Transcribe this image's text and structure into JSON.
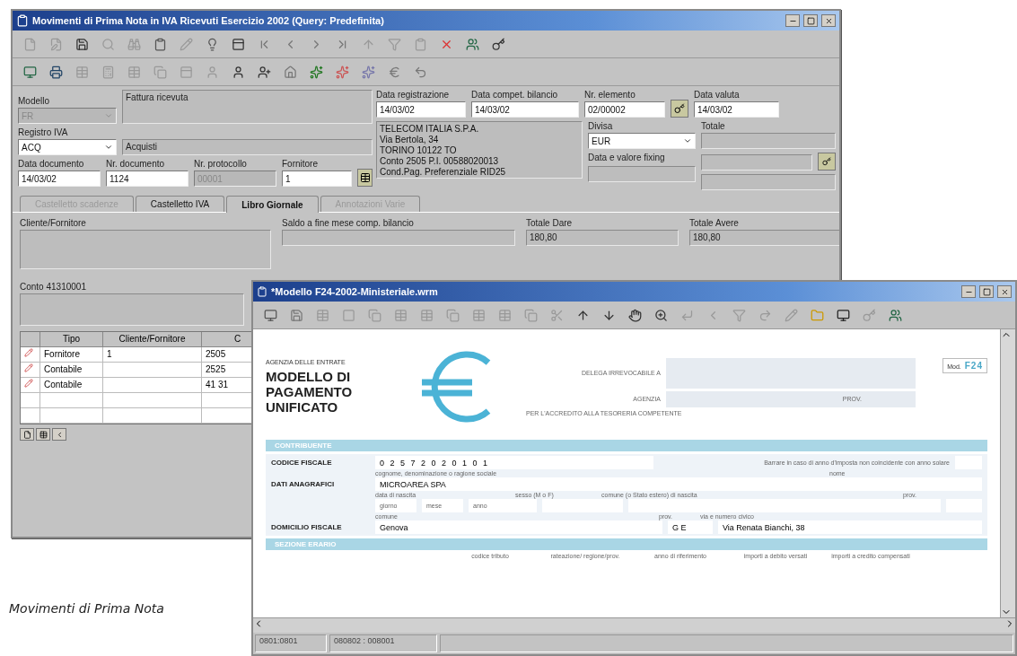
{
  "main_window": {
    "title": "Movimenti di Prima Nota in IVA Ricevuti Esercizio 2002 (Query: Predefinita)",
    "modello": {
      "label": "Modello",
      "value": "FR",
      "disabled": true
    },
    "causale": {
      "value": "Fattura ricevuta"
    },
    "data_registrazione": {
      "label": "Data registrazione",
      "value": "14/03/02"
    },
    "data_compet": {
      "label": "Data compet. bilancio",
      "value": "14/03/02"
    },
    "nr_elemento": {
      "label": "Nr. elemento",
      "value": "02/00002"
    },
    "data_valuta": {
      "label": "Data valuta",
      "value": "14/03/02"
    },
    "registro_iva": {
      "label": "Registro IVA",
      "value": "ACQ",
      "description": "Acquisti"
    },
    "address": [
      "TELECOM ITALIA S.P.A.",
      "Via Bertola, 34",
      "TORINO 10122 TO",
      "Conto 2505 P.I. 00588020013",
      "Cond.Pag. Preferenziale RID25"
    ],
    "divisa": {
      "label": "Divisa",
      "value": "EUR"
    },
    "totale": {
      "label": "Totale"
    },
    "fixing": {
      "label": "Data e valore fixing"
    },
    "doc_fields": [
      {
        "label": "Data documento",
        "value": "14/03/02",
        "disabled": false
      },
      {
        "label": "Nr. documento",
        "value": "1124",
        "disabled": false
      },
      {
        "label": "Nr. protocollo",
        "value": "00001",
        "disabled": true
      },
      {
        "label": "Fornitore",
        "value": "1",
        "disabled": false
      }
    ],
    "tabs": [
      {
        "label": "Castelletto scadenze",
        "selected": false,
        "disabled": true
      },
      {
        "label": "Castelletto IVA",
        "selected": false,
        "disabled": false
      },
      {
        "label": "Libro Giornale",
        "selected": true,
        "disabled": false
      },
      {
        "label": "Annotazioni Varie",
        "selected": false,
        "disabled": true
      }
    ],
    "journal": {
      "cliente_label": "Cliente/Fornitore",
      "saldo_label": "Saldo a fine mese comp. bilancio",
      "dare_label": "Totale Dare",
      "dare_value": "180,80",
      "avere_label": "Totale Avere",
      "avere_value": "180,80",
      "conto_label": "Conto 41310001"
    },
    "table": {
      "columns": [
        "Tipo",
        "Cliente/Fornitore",
        "C"
      ],
      "rows": [
        {
          "tipo": "Fornitore",
          "cliente": "1",
          "column_3": "2505"
        },
        {
          "tipo": "Contabile",
          "cliente": "",
          "column_3": "2525"
        },
        {
          "tipo": "Contabile",
          "cliente": "",
          "column_3": "41 31"
        }
      ]
    }
  },
  "form_window": {
    "title": "*Modello F24-2002-Ministeriale.wrm",
    "agency": "AGENZIA DELLE ENTRATE",
    "heading": "MODELLO DI PAGAMENTO UNIFICATO",
    "delega_label": "DELEGA IRREVOCABILE A",
    "agenzia_label": "AGENZIA",
    "prov_label": "PROV.",
    "accredito_label": "PER L'ACCREDITO ALLA TESORERIA COMPETENTE",
    "badge_prefix": "Mod.",
    "badge_code": "F24",
    "section_1": "CONTRIBUENTE",
    "codice_fiscale_label": "CODICE FISCALE",
    "codice_fiscale": "0 2 5 7 2 0 2 0 1 0 1",
    "anno_note": "Barrare in caso di anno d'imposta non coincidente con anno solare",
    "anno_checked": false,
    "dati_label": "DATI ANAGRAFICI",
    "cognome_hint": "cognome, denominazione o ragione sociale",
    "nome_hint": "nome",
    "ragione_sociale": "MICROAREA SPA",
    "nascita_hint": "data di nascita",
    "giorno_hint": "giorno",
    "mese_hint": "mese",
    "anno_hint": "anno",
    "sesso_hint": "sesso (M o F)",
    "comune_nascita_hint": "comune (o Stato estero) di nascita",
    "prov_nascita_hint": "prov.",
    "domicilio_label": "DOMICILIO FISCALE",
    "comune_hint": "comune",
    "prov_hint": "prov.",
    "via_hint": "via e numero civico",
    "comune": "Genova",
    "prov": "G E",
    "via": "Via Renata Bianchi, 38",
    "section_2": "SEZIONE ERARIO",
    "erario_columns": [
      "codice tributo",
      "rateazione/ regione/prov.",
      "anno di riferimento",
      "importi a debito versati",
      "importi a credito compensati"
    ],
    "status_bar": [
      "0801:0801",
      "080802 : 008001"
    ]
  },
  "caption": "Movimenti di Prima Nota"
}
